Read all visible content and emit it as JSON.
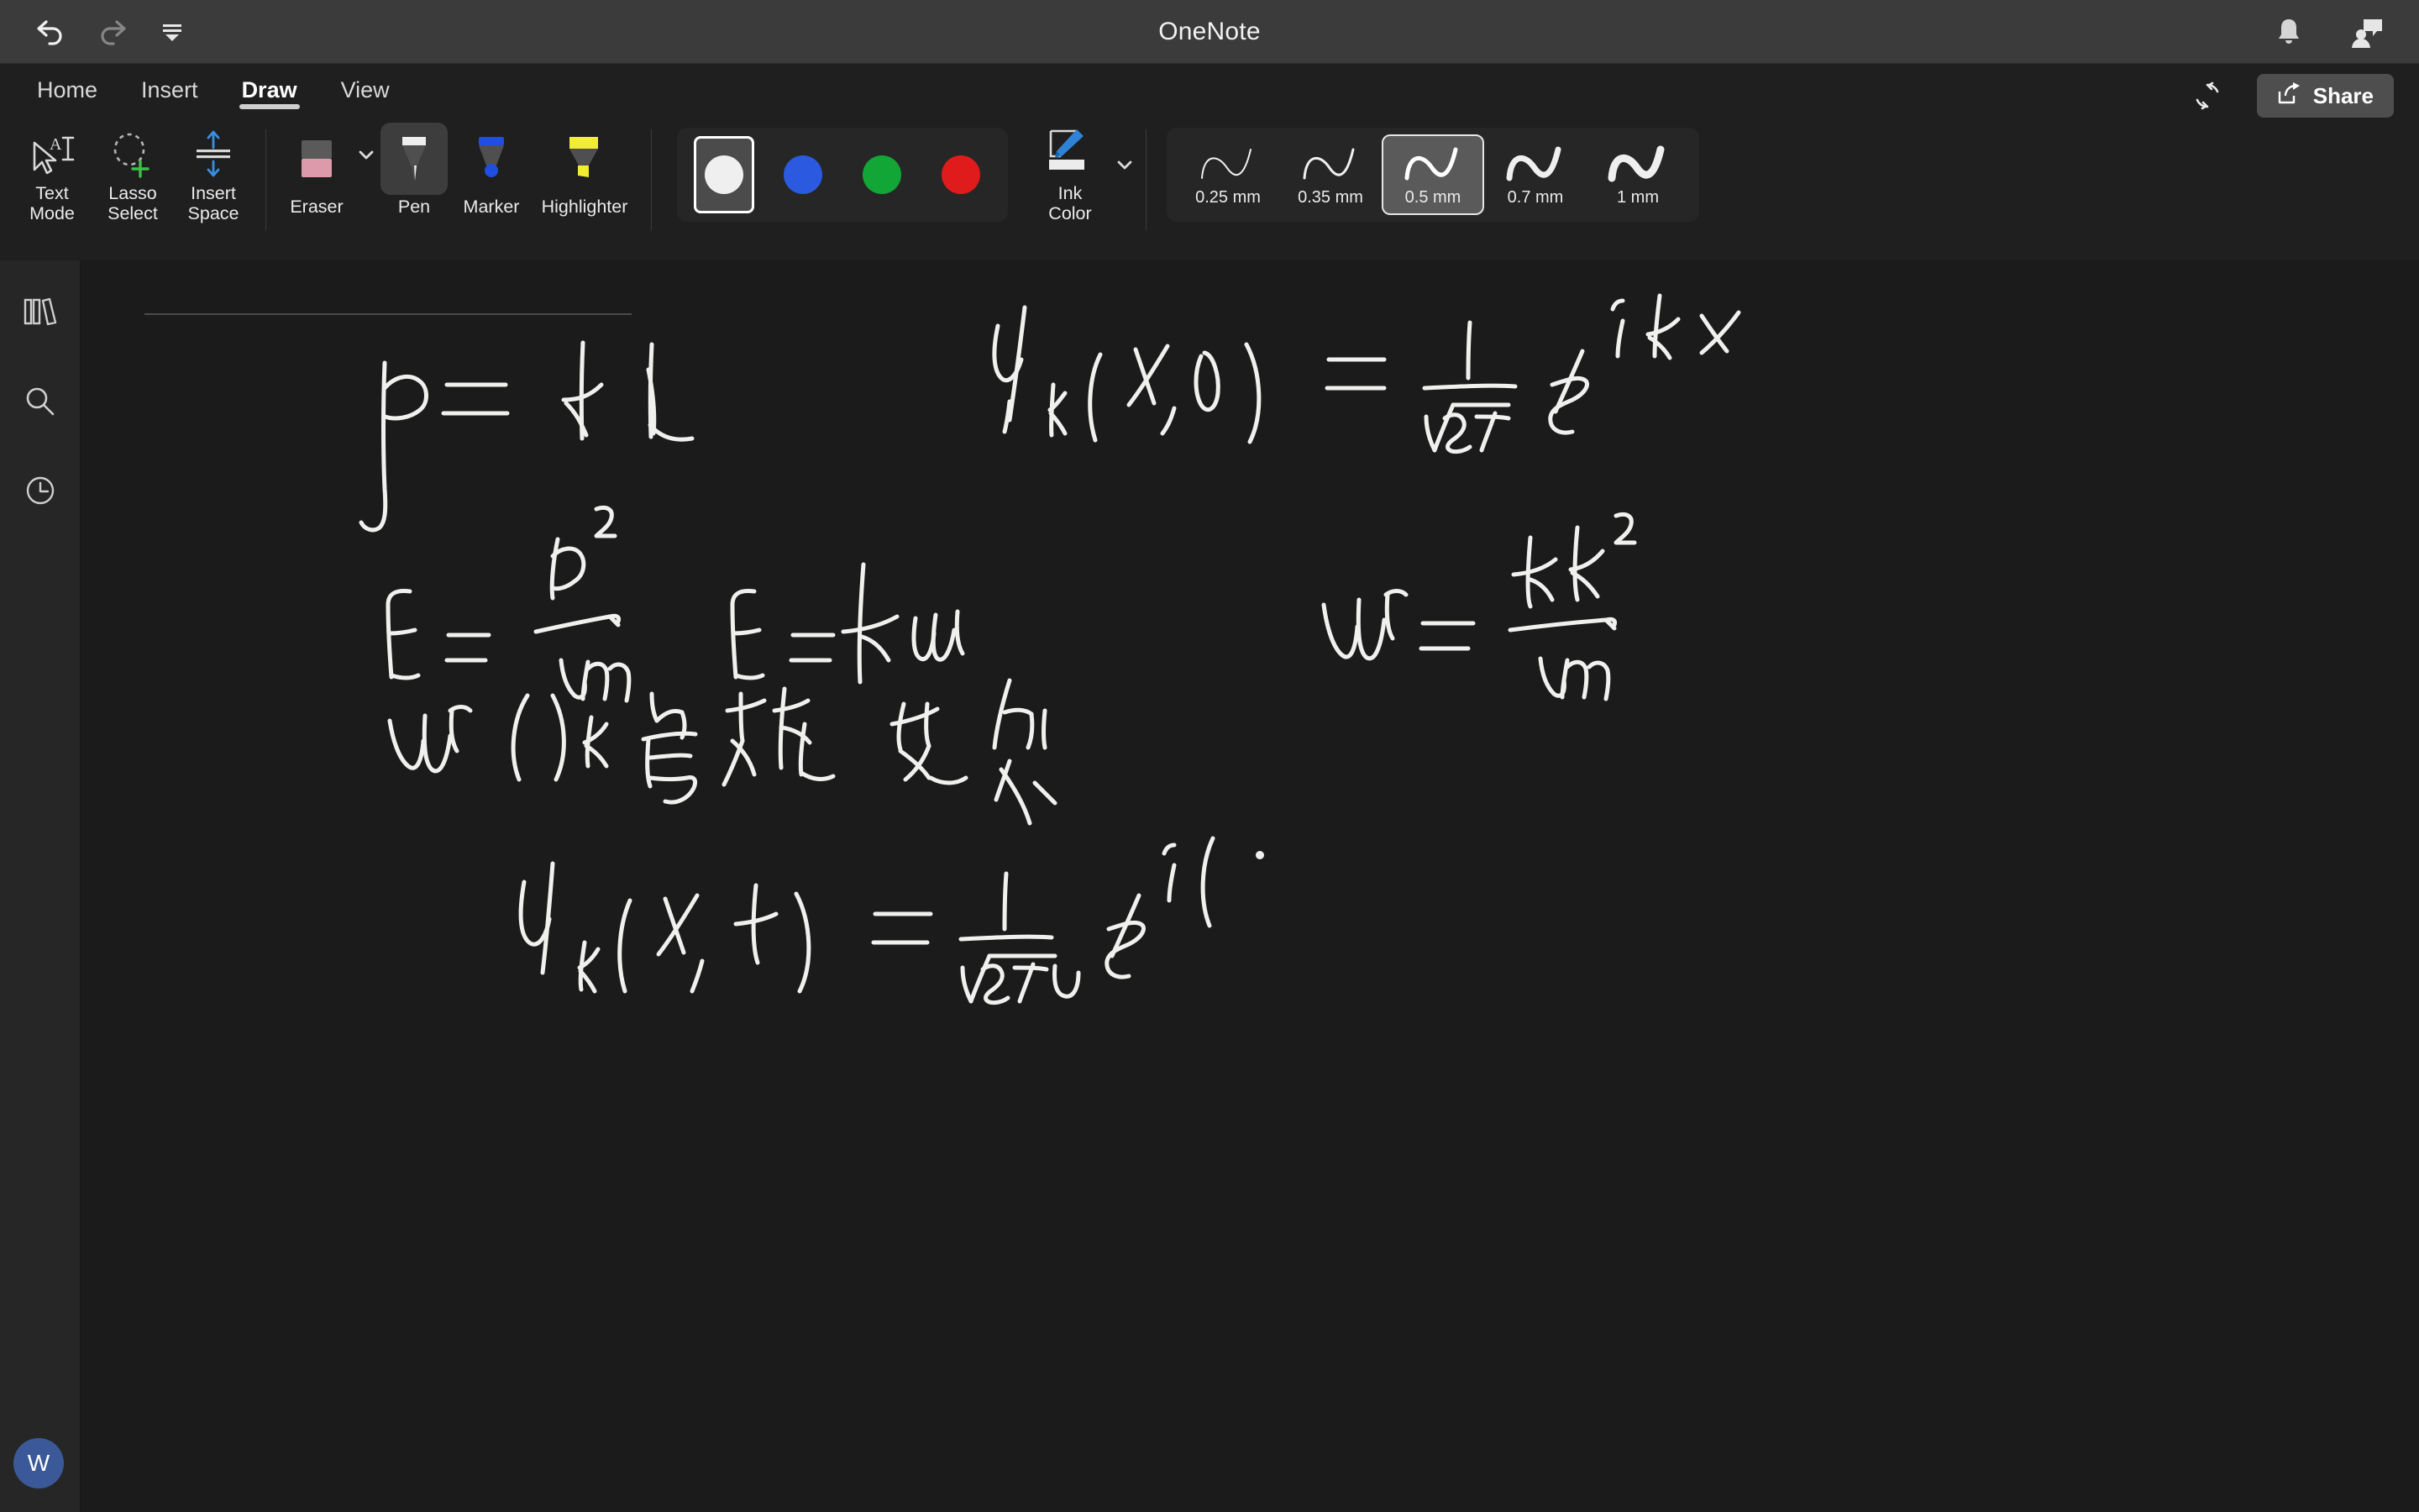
{
  "window": {
    "title": "OneNote",
    "titlebar_icons": [
      {
        "name": "undo-icon",
        "label": "Undo"
      },
      {
        "name": "redo-icon",
        "label": "Redo"
      },
      {
        "name": "customize-toolbar-icon",
        "label": "Customize Toolbar"
      }
    ],
    "right_icons": [
      {
        "name": "notifications-bell-icon",
        "label": "Notifications"
      },
      {
        "name": "chat-person-icon",
        "label": "Contact / Comments"
      }
    ]
  },
  "ribbon": {
    "tabs": [
      {
        "label": "Home",
        "active": false
      },
      {
        "label": "Insert",
        "active": false
      },
      {
        "label": "Draw",
        "active": true
      },
      {
        "label": "View",
        "active": false
      }
    ],
    "sync_label": "Sync",
    "share_label": "Share",
    "tools": [
      {
        "name": "text-mode",
        "label": "Text\nMode"
      },
      {
        "name": "lasso-select",
        "label": "Lasso\nSelect"
      },
      {
        "name": "insert-space",
        "label": "Insert\nSpace"
      }
    ],
    "pens": [
      {
        "name": "eraser",
        "label": "Eraser",
        "selected": false
      },
      {
        "name": "pen",
        "label": "Pen",
        "selected": true
      },
      {
        "name": "marker",
        "label": "Marker",
        "selected": false
      },
      {
        "name": "highlighter",
        "label": "Highlighter",
        "selected": false
      }
    ],
    "colors": [
      {
        "name": "white",
        "hex": "#efefef",
        "selected": true
      },
      {
        "name": "blue",
        "hex": "#2b59e0",
        "selected": false
      },
      {
        "name": "green",
        "hex": "#11a636",
        "selected": false
      },
      {
        "name": "red",
        "hex": "#e01b1b",
        "selected": false
      }
    ],
    "ink_color": {
      "label": "Ink\nColor",
      "current_hex": "#efefef"
    },
    "thickness": [
      {
        "label": "0.25 mm",
        "stroke": 2,
        "selected": false
      },
      {
        "label": "0.35 mm",
        "stroke": 3,
        "selected": false
      },
      {
        "label": "0.5 mm",
        "stroke": 5,
        "selected": true
      },
      {
        "label": "0.7 mm",
        "stroke": 7,
        "selected": false
      },
      {
        "label": "1 mm",
        "stroke": 9,
        "selected": false
      }
    ]
  },
  "sidebar": {
    "items": [
      {
        "name": "notebooks-icon",
        "label": "Notebooks"
      },
      {
        "name": "search-icon",
        "label": "Search"
      },
      {
        "name": "recent-notes-icon",
        "label": "Recent Notes"
      }
    ],
    "avatar_initial": "W"
  },
  "canvas": {
    "page_title": "",
    "ink_color": "#f0f0ee",
    "notes": [
      {
        "id": "eq-momentum",
        "transcription": "p = ℏk"
      },
      {
        "id": "eq-wavefunction-0",
        "transcription": "ψ_k(x,0) = 1/√(2π) e^(ikx)"
      },
      {
        "id": "eq-energy-p2",
        "transcription": "E = p²/2m"
      },
      {
        "id": "eq-energy-hw",
        "transcription": "E = ℏw"
      },
      {
        "id": "eq-omega-k",
        "transcription": "w = ℏk²/2m"
      },
      {
        "id": "note-dispersion",
        "transcription": "w(k) 色散关系"
      },
      {
        "id": "eq-wavefunction-t",
        "transcription": "ψ_k(x,t) = 1/√(2πν) e^(i("
      }
    ]
  }
}
